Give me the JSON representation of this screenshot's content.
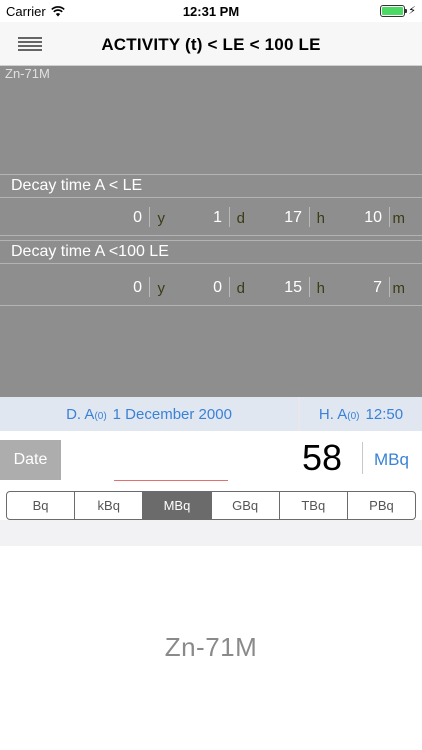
{
  "status": {
    "carrier": "Carrier",
    "time": "12:31 PM"
  },
  "nav": {
    "title": "ACTIVITY (t) < LE < 100 LE"
  },
  "panel": {
    "nuclide": "Zn-71M",
    "decay_le": {
      "title": "Decay time A < LE",
      "values": {
        "y": "0",
        "d": "1",
        "h": "17",
        "m": "10"
      },
      "units": {
        "y": "y",
        "d": "d",
        "h": "h",
        "m": "m"
      }
    },
    "decay_100le": {
      "title": "Decay time A <100 LE",
      "values": {
        "y": "0",
        "d": "0",
        "h": "15",
        "m": "7"
      },
      "units": {
        "y": "y",
        "d": "d",
        "h": "h",
        "m": "m"
      }
    }
  },
  "datebar": {
    "date_label": "D. A",
    "date_sub": "(0)",
    "date_value": "1 December 2000",
    "hour_label": "H. A",
    "hour_sub": "(0)",
    "hour_value": "12:50"
  },
  "input": {
    "date_button": "Date",
    "value": "58",
    "unit": "MBq"
  },
  "units": [
    "Bq",
    "kBq",
    "MBq",
    "GBq",
    "TBq",
    "PBq"
  ],
  "selected_unit": "MBq",
  "footer": {
    "nuclide": "Zn-71M"
  },
  "colors": {
    "accent": "#3a82d6",
    "panel": "#8e8e8e",
    "battery": "#4cd964"
  }
}
